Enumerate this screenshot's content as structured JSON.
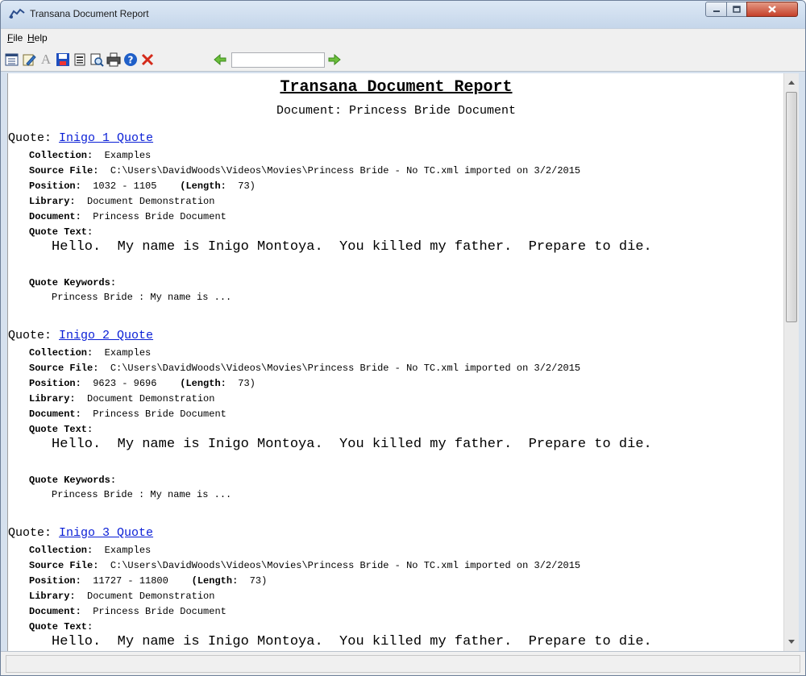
{
  "window": {
    "title": "Transana Document Report",
    "icon": "transana-app-icon"
  },
  "menu": {
    "file": "File",
    "help": "Help"
  },
  "toolbar": {
    "search_value": "",
    "icons": [
      "report-options-icon",
      "edit-icon",
      "font-icon",
      "save-icon",
      "print-setup-icon",
      "print-preview-icon",
      "print-icon",
      "help-icon",
      "close-icon",
      "search-back-icon",
      "search-forward-icon"
    ]
  },
  "report": {
    "title": "Transana Document Report",
    "subtitle": "Document: Princess Bride Document",
    "quotes": [
      {
        "label": "Quote:",
        "name": "Inigo 1 Quote",
        "collection_label": "Collection:",
        "collection": "Examples",
        "source_label": "Source File:",
        "source": "C:\\Users\\DavidWoods\\Videos\\Movies\\Princess Bride - No TC.xml imported on 3/2/2015",
        "position_label": "Position:",
        "position": "1032 - 1105",
        "length_label": "(Length:",
        "length": "73)",
        "library_label": "Library:",
        "library": "Document Demonstration",
        "document_label": "Document:",
        "document": "Princess Bride Document",
        "text_label": "Quote Text:",
        "text": "Hello.  My name is Inigo Montoya.  You killed my father.  Prepare to die.",
        "keywords_label": "Quote Keywords:",
        "keywords": "Princess Bride : My name is ..."
      },
      {
        "label": "Quote:",
        "name": "Inigo 2 Quote",
        "collection_label": "Collection:",
        "collection": "Examples",
        "source_label": "Source File:",
        "source": "C:\\Users\\DavidWoods\\Videos\\Movies\\Princess Bride - No TC.xml imported on 3/2/2015",
        "position_label": "Position:",
        "position": "9623 - 9696",
        "length_label": "(Length:",
        "length": "73)",
        "library_label": "Library:",
        "library": "Document Demonstration",
        "document_label": "Document:",
        "document": "Princess Bride Document",
        "text_label": "Quote Text:",
        "text": "Hello.  My name is Inigo Montoya.  You killed my father.  Prepare to die.",
        "keywords_label": "Quote Keywords:",
        "keywords": "Princess Bride : My name is ..."
      },
      {
        "label": "Quote:",
        "name": "Inigo 3 Quote",
        "collection_label": "Collection:",
        "collection": "Examples",
        "source_label": "Source File:",
        "source": "C:\\Users\\DavidWoods\\Videos\\Movies\\Princess Bride - No TC.xml imported on 3/2/2015",
        "position_label": "Position:",
        "position": "11727 - 11800",
        "length_label": "(Length:",
        "length": "73)",
        "library_label": "Library:",
        "library": "Document Demonstration",
        "document_label": "Document:",
        "document": "Princess Bride Document",
        "text_label": "Quote Text:",
        "text": "Hello.  My name is Inigo Montoya.  You killed my father.  Prepare to die."
      }
    ]
  },
  "colors": {
    "link": "#0a1fd6",
    "close_button": "#c5402a"
  }
}
